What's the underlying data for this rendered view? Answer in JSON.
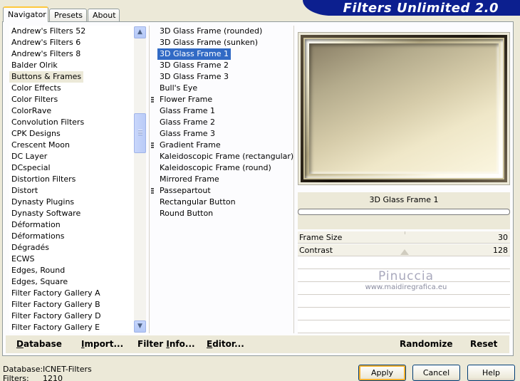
{
  "app_title": "Filters Unlimited 2.0",
  "tabs": [
    {
      "label": "Navigator",
      "active": true
    },
    {
      "label": "Presets",
      "active": false
    },
    {
      "label": "About",
      "active": false
    }
  ],
  "categories": {
    "selected": "Buttons & Frames",
    "items": [
      "Andrew's Filters 52",
      "Andrew's Filters 6",
      "Andrew's Filters 8",
      "Balder Olrik",
      "Buttons & Frames",
      "Color Effects",
      "Color Filters",
      "ColorRave",
      "Convolution Filters",
      "CPK Designs",
      "Crescent Moon",
      "DC Layer",
      "DCspecial",
      "Distortion Filters",
      "Distort",
      "Dynasty Plugins",
      "Dynasty Software",
      "Déformation",
      "Déformations",
      "Dégradés",
      "ECWS",
      "Edges, Round",
      "Edges, Square",
      "Filter Factory Gallery A",
      "Filter Factory Gallery B",
      "Filter Factory Gallery D",
      "Filter Factory Gallery E"
    ]
  },
  "filters": {
    "selected": "3D Glass Frame 1",
    "items": [
      {
        "label": "3D Glass Frame (rounded)",
        "group": false
      },
      {
        "label": "3D Glass Frame (sunken)",
        "group": false
      },
      {
        "label": "3D Glass Frame 1",
        "group": false
      },
      {
        "label": "3D Glass Frame 2",
        "group": false
      },
      {
        "label": "3D Glass Frame 3",
        "group": false
      },
      {
        "label": "Bull's Eye",
        "group": false
      },
      {
        "label": "Flower Frame",
        "group": true
      },
      {
        "label": "Glass Frame 1",
        "group": false
      },
      {
        "label": "Glass Frame 2",
        "group": false
      },
      {
        "label": "Glass Frame 3",
        "group": false
      },
      {
        "label": "Gradient Frame",
        "group": true
      },
      {
        "label": "Kaleidoscopic Frame (rectangular)",
        "group": false
      },
      {
        "label": "Kaleidoscopic Frame (round)",
        "group": false
      },
      {
        "label": "Mirrored Frame",
        "group": false
      },
      {
        "label": "Passepartout",
        "group": true
      },
      {
        "label": "Rectangular Button",
        "group": false
      },
      {
        "label": "Round Button",
        "group": false
      }
    ]
  },
  "preview": {
    "filter_name": "3D Glass Frame 1"
  },
  "params": [
    {
      "label": "Frame Size",
      "value": "30"
    },
    {
      "label": "Contrast",
      "value": "128"
    }
  ],
  "watermark": {
    "name": "Pinuccia",
    "url": "www.maidiregrafica.eu"
  },
  "toolbar": {
    "database": {
      "pre": "",
      "u": "D",
      "post": "atabase"
    },
    "import": {
      "pre": "",
      "u": "I",
      "post": "mport..."
    },
    "filter_info": {
      "pre": "Filter ",
      "u": "I",
      "post": "nfo..."
    },
    "editor": {
      "pre": "",
      "u": "E",
      "post": "ditor..."
    },
    "randomize": "Randomize",
    "reset": "Reset"
  },
  "status": {
    "database_label": "Database:",
    "database_value": "ICNET-Filters",
    "filters_label": "Filters:",
    "filters_value": "1210"
  },
  "buttons": {
    "apply": "Apply",
    "cancel": "Cancel",
    "help": "Help"
  },
  "colors": {
    "banner": "#0c1f8f",
    "selection": "#316ac5",
    "default_button_glow": "#f8b330"
  }
}
